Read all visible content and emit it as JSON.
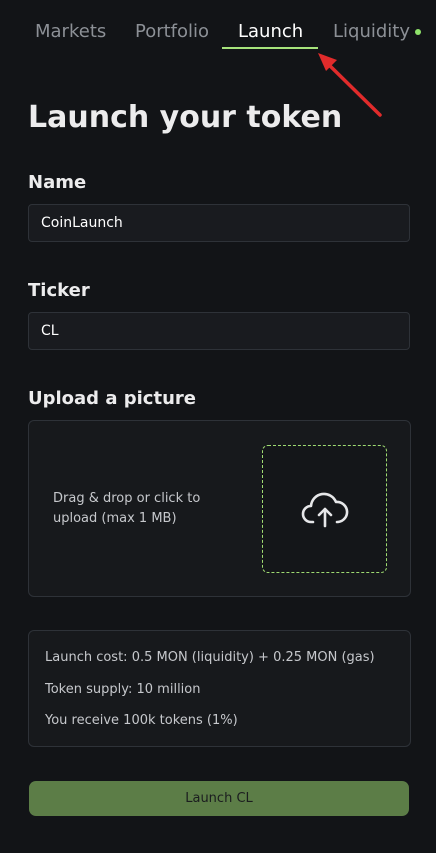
{
  "nav": {
    "tabs": [
      {
        "label": "Markets"
      },
      {
        "label": "Portfolio"
      },
      {
        "label": "Launch",
        "active": true
      },
      {
        "label": "Liquidity"
      }
    ],
    "status_color": "#8fe36a",
    "accent_color": "#a6e37b"
  },
  "page": {
    "title": "Launch your token"
  },
  "form": {
    "name": {
      "label": "Name",
      "value": "CoinLaunch"
    },
    "ticker": {
      "label": "Ticker",
      "value": "CL"
    },
    "upload": {
      "label": "Upload a picture",
      "hint": "Drag & drop or click to upload (max 1 MB)",
      "icon": "cloud-upload-icon"
    }
  },
  "info": {
    "launch_cost": "Launch cost: 0.5 MON (liquidity) + 0.25 MON (gas)",
    "token_supply": "Token supply: 10 million",
    "receive": "You receive 100k tokens (1%)"
  },
  "actions": {
    "launch_label": "Launch CL",
    "launch_color": "#5c7d47"
  },
  "annotation": {
    "arrow_color": "#e02b2b"
  }
}
